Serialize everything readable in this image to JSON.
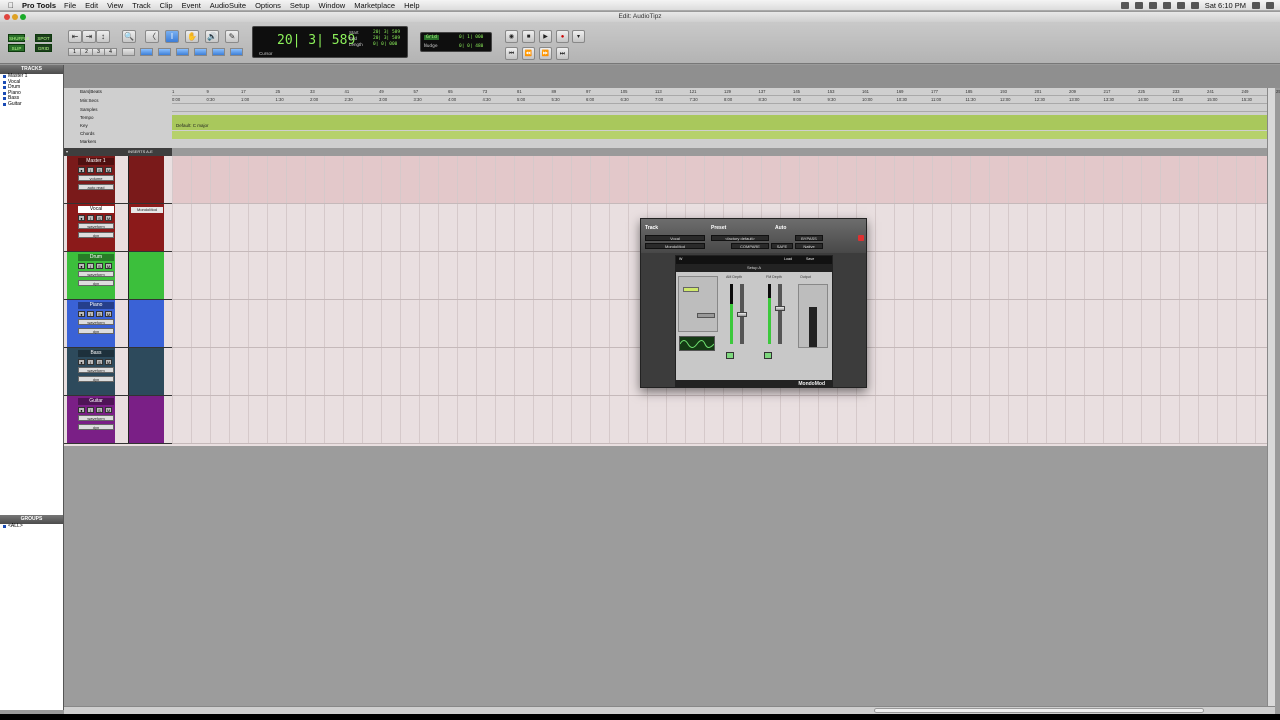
{
  "menubar": {
    "app_name": "Pro Tools",
    "menus": [
      "File",
      "Edit",
      "View",
      "Track",
      "Clip",
      "Event",
      "AudioSuite",
      "Options",
      "Setup",
      "Window",
      "Marketplace",
      "Help"
    ],
    "clock": "Sat 6:10 PM"
  },
  "window": {
    "title": "Edit: AudioTipz"
  },
  "toolbar": {
    "modes": [
      "SHUFFLE",
      "SPOT",
      "SLIP",
      "GRID"
    ],
    "counter_main": "20| 3| 589",
    "counter_labels": [
      "Start",
      "End",
      "Length"
    ],
    "counter_values": [
      "20| 3| 589",
      "20| 3| 589",
      "0| 0| 000"
    ],
    "cursor_label": "Cursor",
    "grid_label": "Grid",
    "nudge_label": "Nudge",
    "grid_value": "0| 1| 000",
    "nudge_value": "0| 0| 480"
  },
  "panels": {
    "tracks_title": "TRACKS",
    "groups_title": "GROUPS",
    "group_all": "<ALL>",
    "track_list": [
      "Master 1",
      "Vocal",
      "Drum",
      "Piano",
      "Bass",
      "Guitar"
    ]
  },
  "rulers": {
    "labels": [
      "Bars|Beats",
      "Min:Secs",
      "Samples",
      "Tempo",
      "Key",
      "Chords",
      "Markers"
    ],
    "bars": [
      "1",
      "9",
      "17",
      "25",
      "33",
      "41",
      "49",
      "57",
      "65",
      "73",
      "81",
      "89",
      "97",
      "105",
      "113",
      "121",
      "129",
      "137",
      "145",
      "153",
      "161",
      "169",
      "177",
      "185",
      "193",
      "201",
      "209",
      "217",
      "225",
      "233",
      "241",
      "249",
      "257"
    ],
    "minsecs": [
      "0:00",
      "0:30",
      "1:00",
      "1:30",
      "2:00",
      "2:30",
      "3:00",
      "3:30",
      "4:00",
      "4:30",
      "5:00",
      "5:30",
      "6:00",
      "6:30",
      "7:00",
      "7:30",
      "8:00",
      "8:30",
      "9:00",
      "9:30",
      "10:00",
      "10:30",
      "11:00",
      "11:30",
      "12:00",
      "12:30",
      "13:00",
      "13:30",
      "14:00",
      "14:30",
      "15:00",
      "15:30"
    ],
    "key_label": "Default: C major",
    "tempo_value": "120"
  },
  "columns": {
    "inserts_label": "INSERTS A-E"
  },
  "tracks": [
    {
      "name": "Master 1",
      "color": "#7a1a1a",
      "ctrl1": "volume",
      "ctrl2": "auto read",
      "insert": ""
    },
    {
      "name": "Vocal",
      "color": "#8b1a1a",
      "ctrl1": "waveform",
      "ctrl2": "dyn",
      "insert": "MondoMod"
    },
    {
      "name": "Drum",
      "color": "#3cbf3c",
      "ctrl1": "waveform",
      "ctrl2": "dyn",
      "insert": ""
    },
    {
      "name": "Piano",
      "color": "#3a62d6",
      "ctrl1": "waveform",
      "ctrl2": "dyn",
      "insert": ""
    },
    {
      "name": "Bass",
      "color": "#2d4a5c",
      "ctrl1": "waveform",
      "ctrl2": "dyn",
      "insert": ""
    },
    {
      "name": "Guitar",
      "color": "#7a1f86",
      "ctrl1": "waveform",
      "ctrl2": "dyn",
      "insert": ""
    }
  ],
  "plugin": {
    "track_label": "Track",
    "preset_label": "Preset",
    "auto_label": "Auto",
    "track_value": "Vocal",
    "insert_value": "MondoMod",
    "preset_value": "<factory default>",
    "compare": "COMPARE",
    "bypass": "BYPASS",
    "safe": "SAFE",
    "native": "Native",
    "setup_label": "Setup A",
    "load": "Load",
    "save": "Save",
    "am_depth": "AM Depth",
    "fm_depth": "FM Depth",
    "output": "Output",
    "brand": "MondoMod"
  },
  "colors": {
    "accent_green": "#8cf05a",
    "key_strip": "#a9c85c",
    "close_red": "#e03030"
  }
}
